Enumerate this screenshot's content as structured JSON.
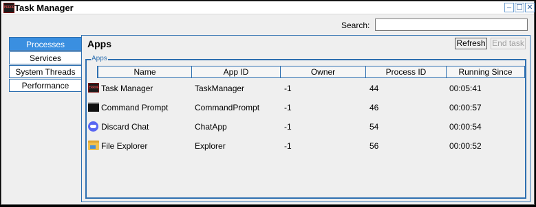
{
  "window": {
    "title": "Task Manager",
    "app_icon_text": "ERROR",
    "controls": {
      "minimize": "–",
      "maximize": "☐",
      "close": "✕"
    }
  },
  "search": {
    "label": "Search:",
    "value": "",
    "placeholder": ""
  },
  "sidebar": {
    "items": [
      {
        "label": "Processes",
        "active": true
      },
      {
        "label": "Services",
        "active": false
      },
      {
        "label": "System Threads",
        "active": false
      },
      {
        "label": "Performance",
        "active": false
      }
    ]
  },
  "main": {
    "title": "Apps",
    "refresh_label": "Refresh",
    "end_task_label": "End task",
    "group_label": "Apps",
    "columns": [
      "Name",
      "App ID",
      "Owner",
      "Process ID",
      "Running Since"
    ],
    "rows": [
      {
        "icon": "task-manager-icon",
        "icon_text": "ERROR",
        "name": "Task Manager",
        "app_id": "TaskManager",
        "owner": "-1",
        "pid": "44",
        "since": "00:05:41"
      },
      {
        "icon": "command-prompt-icon",
        "icon_text": "",
        "name": "Command Prompt",
        "app_id": "CommandPrompt",
        "owner": "-1",
        "pid": "46",
        "since": "00:00:57"
      },
      {
        "icon": "discord-icon",
        "icon_text": "",
        "name": "Discard Chat",
        "app_id": "ChatApp",
        "owner": "-1",
        "pid": "54",
        "since": "00:00:54"
      },
      {
        "icon": "folder-icon",
        "icon_text": "",
        "name": "File Explorer",
        "app_id": "Explorer",
        "owner": "-1",
        "pid": "56",
        "since": "00:00:52"
      }
    ]
  },
  "colors": {
    "accent": "#2d6fb0",
    "active_tab": "#3a8fe0",
    "background": "#efefef"
  }
}
